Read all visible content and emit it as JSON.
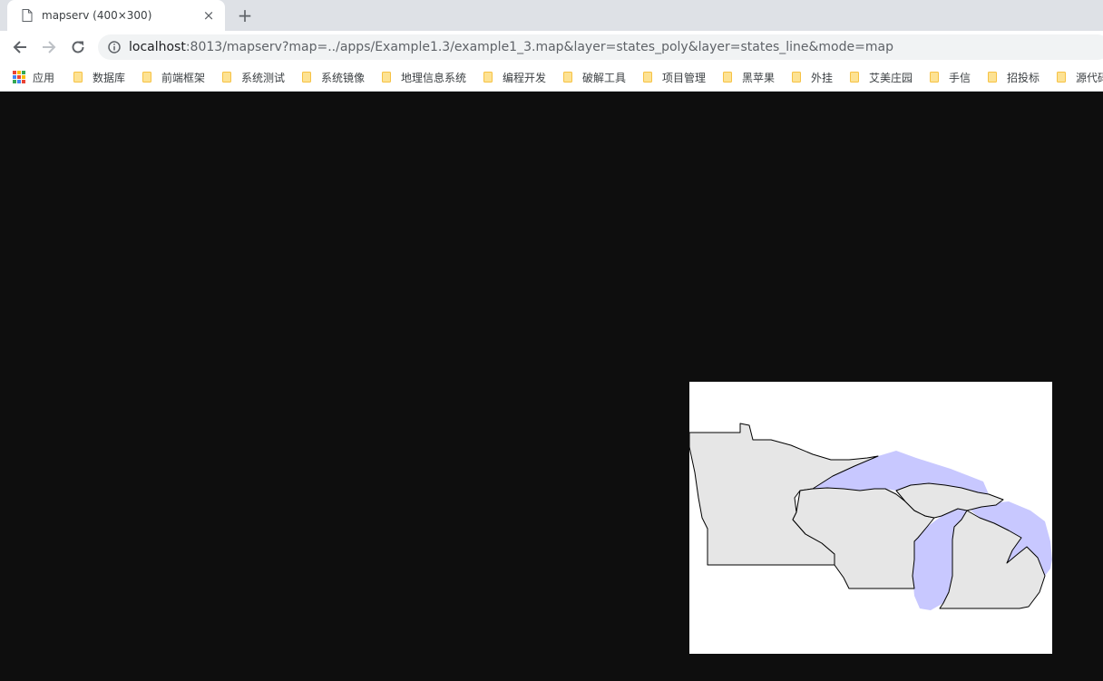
{
  "tab": {
    "title": "mapserv (400×300)",
    "close_label": "×"
  },
  "new_tab_label": "+",
  "address_bar": {
    "host": "localhost",
    "rest": ":8013/mapserv?map=../apps/Example1.3/example1_3.map&layer=states_poly&layer=states_line&mode=map"
  },
  "bookmarks": {
    "apps_label": "应用",
    "items": [
      "数据库",
      "前端框架",
      "系统测试",
      "系统镜像",
      "地理信息系统",
      "编程开发",
      "破解工具",
      "项目管理",
      "黑苹果",
      "外挂",
      "艾美庄园",
      "手信",
      "招投标",
      "源代码"
    ]
  },
  "icons": {
    "back": "arrow-left-icon",
    "forward": "arrow-right-icon",
    "reload": "reload-icon",
    "info": "info-icon",
    "page": "page-icon",
    "folder": "folder-icon",
    "apps": "apps-grid-icon"
  },
  "map": {
    "land_color": "#e6e6e6",
    "water_color": "#c8c8ff",
    "border_color": "#000000",
    "background_color": "#ffffff"
  }
}
